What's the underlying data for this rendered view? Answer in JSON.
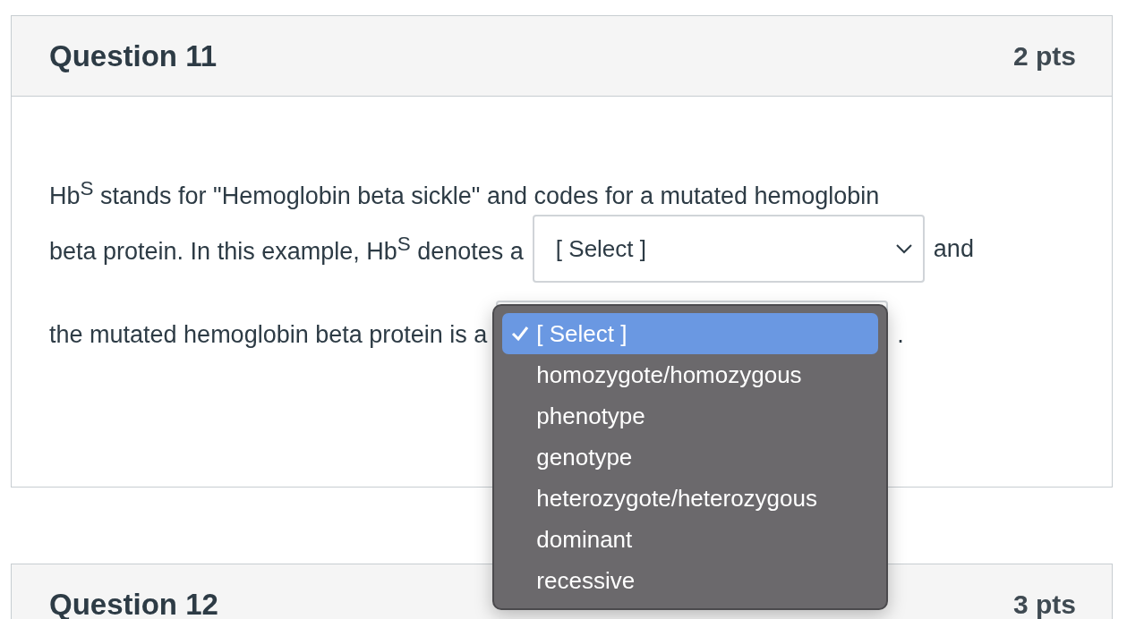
{
  "questions": [
    {
      "title": "Question 11",
      "points": "2 pts",
      "lines": [
        [
          {
            "kind": "text",
            "text": "Hb$^{S}$ stands for \"Hemoglobin beta sickle\" and codes for a mutated hemoglobin"
          }
        ],
        [
          {
            "kind": "text",
            "text": "beta protein. In this example, Hb$^{S}$ denotes a"
          },
          {
            "kind": "select",
            "value": "[ Select ]"
          },
          {
            "kind": "text",
            "text": "and"
          }
        ],
        [
          {
            "kind": "text",
            "text": "the mutated hemoglobin beta protein is a"
          },
          {
            "kind": "select",
            "expanded": true,
            "options": [
              {
                "label": "[ Select ]",
                "selected": true
              },
              {
                "label": "homozygote/homozygous",
                "selected": false
              },
              {
                "label": "phenotype",
                "selected": false
              },
              {
                "label": "genotype",
                "selected": false
              },
              {
                "label": "heterozygote/heterozygous",
                "selected": false
              },
              {
                "label": "dominant",
                "selected": false
              },
              {
                "label": "recessive",
                "selected": false
              }
            ]
          },
          {
            "kind": "text",
            "text": "."
          }
        ]
      ]
    },
    {
      "title": "Question 12",
      "points": "3 pts"
    }
  ]
}
